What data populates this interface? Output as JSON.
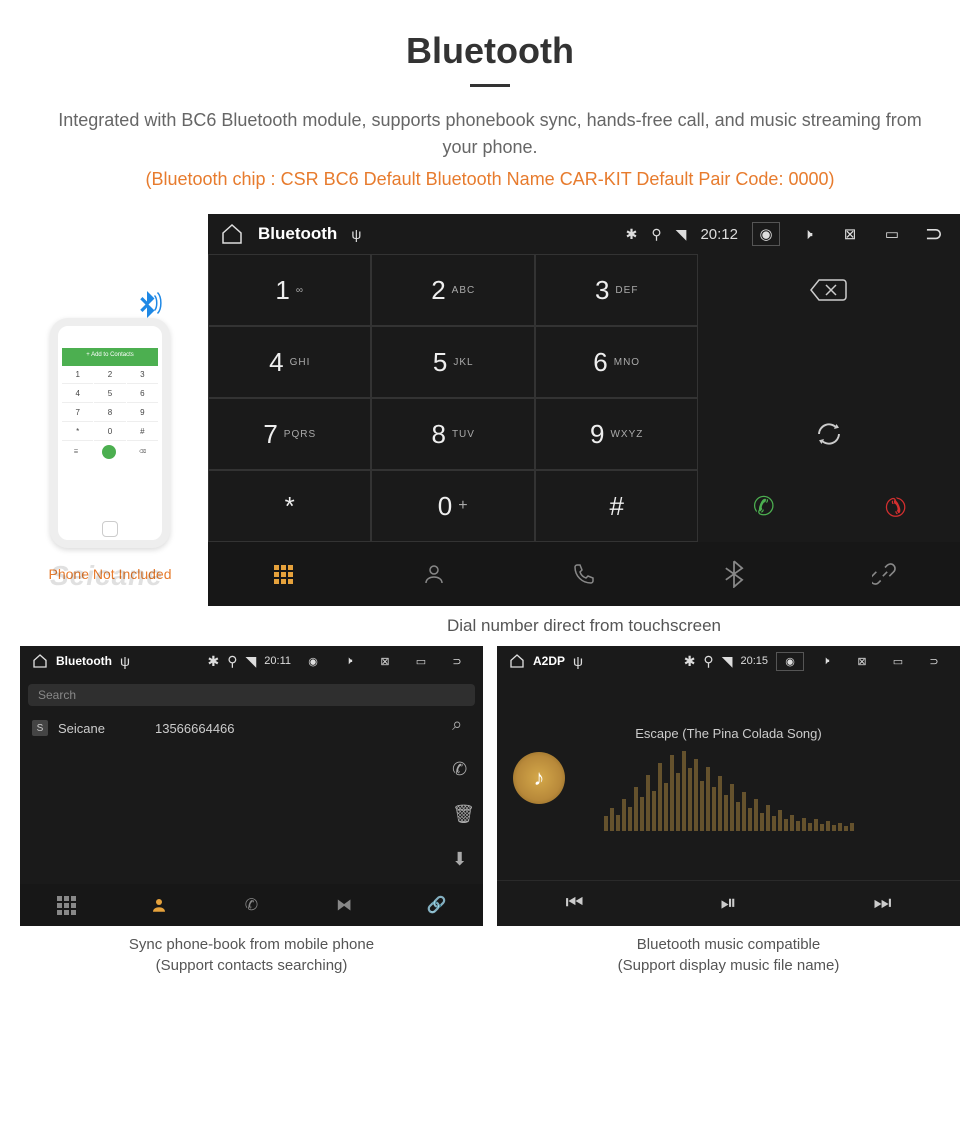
{
  "page": {
    "title": "Bluetooth",
    "intro": "Integrated with BC6 Bluetooth module, supports phonebook sync, hands-free call, and music streaming from your phone.",
    "spec_line": "(Bluetooth chip : CSR BC6     Default Bluetooth Name CAR-KIT     Default Pair Code: 0000)"
  },
  "phone_mock": {
    "header": "+   Add to Contacts",
    "keys": [
      "1",
      "2",
      "3",
      "4",
      "5",
      "6",
      "7",
      "8",
      "9",
      "*",
      "0",
      "#"
    ],
    "watermark": "Seicane",
    "caption": "Phone Not Included"
  },
  "main_device": {
    "status": {
      "title": "Bluetooth",
      "time": "20:12"
    },
    "keypad": [
      {
        "d": "1",
        "l": "∞"
      },
      {
        "d": "2",
        "l": "ABC"
      },
      {
        "d": "3",
        "l": "DEF"
      },
      {
        "d": "4",
        "l": "GHI"
      },
      {
        "d": "5",
        "l": "JKL"
      },
      {
        "d": "6",
        "l": "MNO"
      },
      {
        "d": "7",
        "l": "PQRS"
      },
      {
        "d": "8",
        "l": "TUV"
      },
      {
        "d": "9",
        "l": "WXYZ"
      },
      {
        "d": "*",
        "l": ""
      },
      {
        "d": "0",
        "l": "+"
      },
      {
        "d": "#",
        "l": ""
      }
    ],
    "caption": "Dial number direct from touchscreen"
  },
  "contacts_panel": {
    "status": {
      "title": "Bluetooth",
      "time": "20:11"
    },
    "search_placeholder": "Search",
    "contact": {
      "badge": "S",
      "name": "Seicane",
      "number": "13566664466"
    },
    "caption_line1": "Sync phone-book from mobile phone",
    "caption_line2": "(Support contacts searching)"
  },
  "music_panel": {
    "status": {
      "title": "A2DP",
      "time": "20:15"
    },
    "song": "Escape (The Pina Colada Song)",
    "caption_line1": "Bluetooth music compatible",
    "caption_line2": "(Support display music file name)"
  },
  "colors": {
    "accent": "#e77b2d",
    "amber": "#e6a23c"
  }
}
